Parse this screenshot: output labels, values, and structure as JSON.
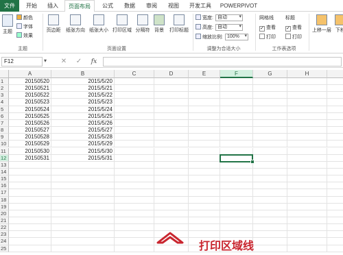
{
  "tabs": [
    "文件",
    "开始",
    "插入",
    "页面布局",
    "公式",
    "数据",
    "审阅",
    "视图",
    "开发工具",
    "POWERPIVOT"
  ],
  "ribbon": {
    "theme_group": {
      "label": "主题",
      "btn": "主题",
      "colors": "颜色",
      "fonts": "字体",
      "effects": "效果"
    },
    "page_setup": {
      "label": "页面设置",
      "margins": "页边距",
      "orientation": "纸张方向",
      "size": "纸张大小",
      "print_area": "打印区域",
      "breaks": "分隔符",
      "background": "背景",
      "print_titles": "打印标题"
    },
    "scale": {
      "label": "调整为合适大小",
      "width_label": "宽度:",
      "width_value": "自动",
      "height_label": "高度:",
      "height_value": "自动",
      "scale_label": "缩放比例:",
      "scale_value": "100%"
    },
    "sheet_options": {
      "label": "工作表选项",
      "gridlines": "网格线",
      "headings": "标题",
      "view": "查看",
      "print": "打印"
    },
    "arrange": {
      "bring_forward": "上移一层",
      "send_backward": "下移"
    }
  },
  "formula_bar": {
    "name_box": "F12",
    "cancel": "✕",
    "enter": "✓",
    "fx": "fx",
    "formula": ""
  },
  "columns": [
    "A",
    "B",
    "C",
    "D",
    "E",
    "F",
    "G",
    "H",
    "I"
  ],
  "rows": [
    "1",
    "2",
    "3",
    "4",
    "5",
    "6",
    "7",
    "8",
    "9",
    "10",
    "11",
    "12",
    "13",
    "14",
    "15",
    "16",
    "17",
    "18",
    "19",
    "20",
    "21",
    "22",
    "23",
    "24",
    "25"
  ],
  "data": [
    [
      "20150520",
      "2015/5/20"
    ],
    [
      "20150521",
      "2015/5/21"
    ],
    [
      "20150522",
      "2015/5/22"
    ],
    [
      "20150523",
      "2015/5/23"
    ],
    [
      "20150524",
      "2015/5/24"
    ],
    [
      "20150525",
      "2015/5/25"
    ],
    [
      "20150526",
      "2015/5/26"
    ],
    [
      "20150527",
      "2015/5/27"
    ],
    [
      "20150528",
      "2015/5/28"
    ],
    [
      "20150529",
      "2015/5/29"
    ],
    [
      "20150530",
      "2015/5/30"
    ],
    [
      "20150531",
      "2015/5/31"
    ]
  ],
  "annotation": "打印区域线",
  "colors": {
    "accent": "#217346",
    "annotation": "#c9262f"
  }
}
